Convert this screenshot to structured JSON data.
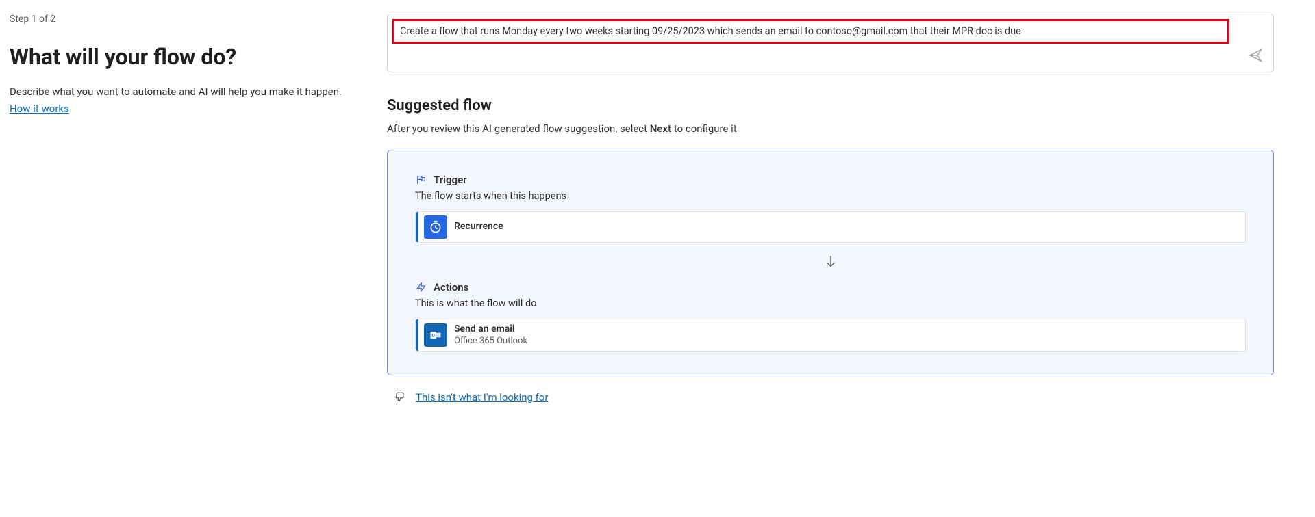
{
  "left": {
    "step": "Step 1 of 2",
    "heading": "What will your flow do?",
    "description": "Describe what you want to automate and AI will help you make it happen.",
    "howItWorks": "How it works"
  },
  "prompt": {
    "text": "Create a flow that runs Monday every two weeks starting 09/25/2023 which sends an email to contoso@gmail.com that their MPR doc is due"
  },
  "suggested": {
    "title": "Suggested flow",
    "subPrefix": "After you review this AI generated flow suggestion, select ",
    "subBold": "Next",
    "subSuffix": " to configure it"
  },
  "trigger": {
    "label": "Trigger",
    "desc": "The flow starts when this happens",
    "item": {
      "title": "Recurrence"
    }
  },
  "actions": {
    "label": "Actions",
    "desc": "This is what the flow will do",
    "item": {
      "title": "Send an email",
      "subtitle": "Office 365 Outlook"
    }
  },
  "feedback": {
    "notLooking": "This isn't what I'm looking for"
  }
}
